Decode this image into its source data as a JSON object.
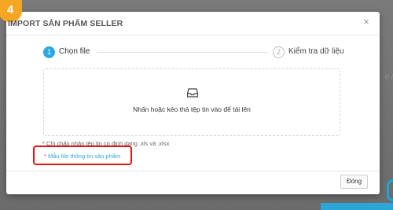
{
  "background": {
    "right_fragment": "0 /",
    "accent_color": "#29a9e1"
  },
  "badge": {
    "number": "4",
    "color": "#f5a623"
  },
  "modal": {
    "title": "IMPORT SẢN PHẨM SELLER",
    "close_icon": "close-icon",
    "close_glyph": "×"
  },
  "steps": [
    {
      "number": "1",
      "label": "Chọn file",
      "active": true
    },
    {
      "number": "2",
      "label": "Kiểm tra dữ liệu",
      "active": false
    }
  ],
  "dropzone": {
    "icon": "inbox-icon",
    "text": "Nhấn hoặc kéo thả tệp tin vào để tải lên"
  },
  "notes": {
    "format_note": "* Chỉ chấp nhận tệp tin có định dạng .xls và .xlsx",
    "template_star": "*",
    "template_link": "Mẫu file thông tin sản phẩm"
  },
  "highlight_color": "#e3141b",
  "footer": {
    "close_label": "Đóng"
  }
}
